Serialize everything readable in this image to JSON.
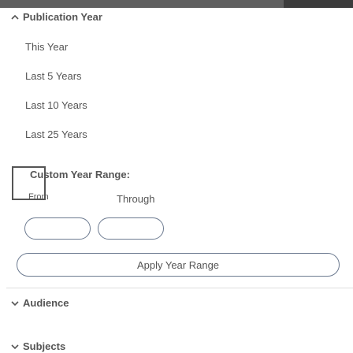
{
  "publication_year": {
    "header": "Publication Year",
    "options": [
      "This Year",
      "Last 5 Years",
      "Last 10 Years",
      "Last 25 Years"
    ],
    "custom_label": "Custom Year Range:",
    "from_label": "From",
    "through_label": "Through",
    "from_value": "",
    "through_value": "",
    "apply_label": "Apply Year Range"
  },
  "audience": {
    "header": "Audience"
  },
  "subjects": {
    "header": "Subjects"
  }
}
